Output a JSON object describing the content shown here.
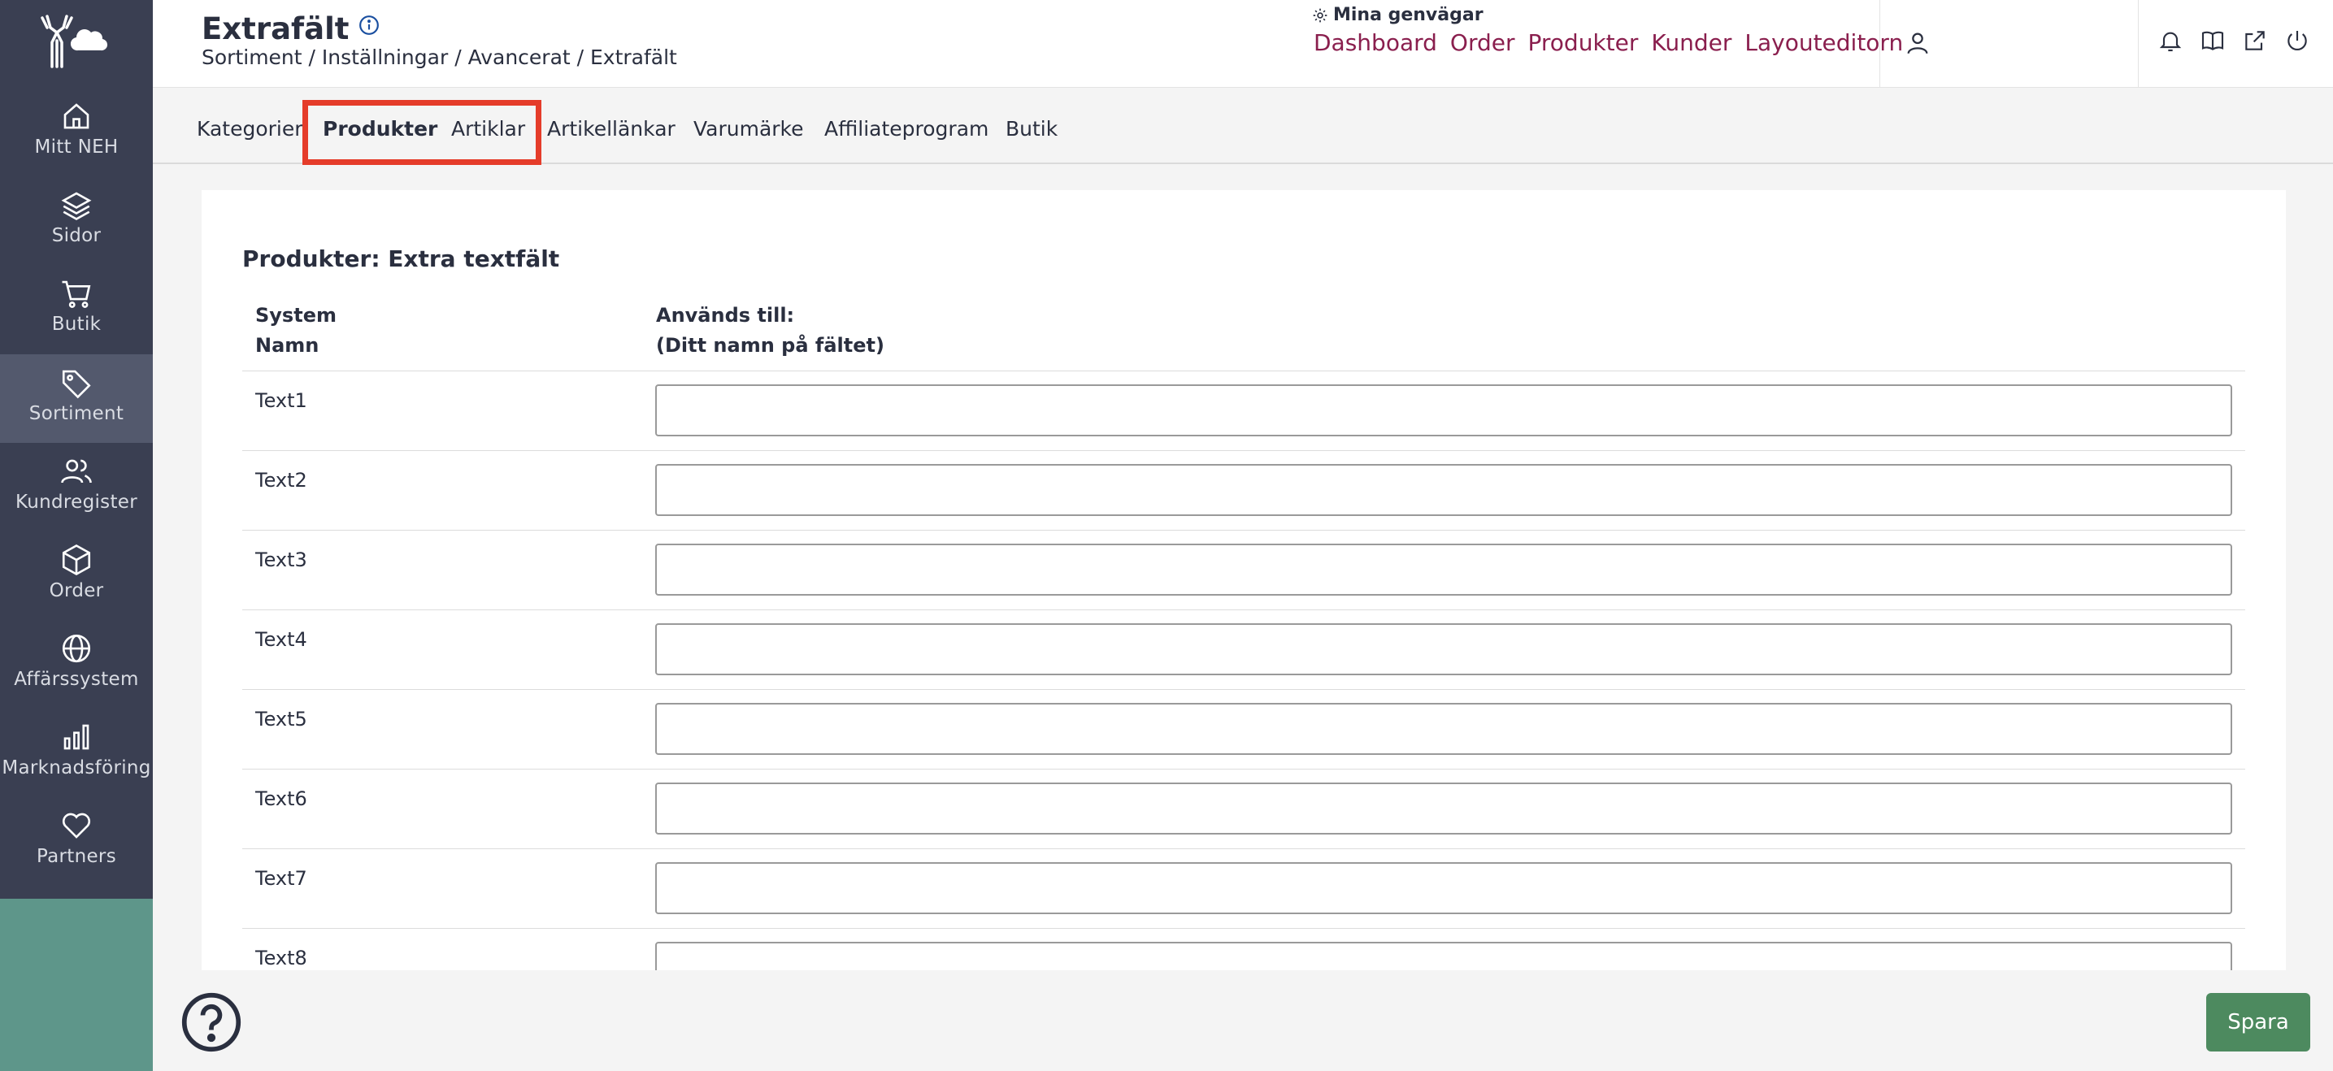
{
  "sidebar": {
    "items": [
      {
        "label": "Mitt NEH",
        "icon": "home-icon"
      },
      {
        "label": "Sidor",
        "icon": "layers-icon"
      },
      {
        "label": "Butik",
        "icon": "cart-icon"
      },
      {
        "label": "Sortiment",
        "icon": "tag-icon"
      },
      {
        "label": "Kundregister",
        "icon": "users-icon"
      },
      {
        "label": "Order",
        "icon": "box-icon"
      },
      {
        "label": "Affärssystem",
        "icon": "globe-icon"
      },
      {
        "label": "Marknadsföring",
        "icon": "bar-chart-icon"
      },
      {
        "label": "Partners",
        "icon": "heart-icon"
      }
    ],
    "active": "Sortiment"
  },
  "header": {
    "title": "Extrafält",
    "breadcrumb": "Sortiment / Inställningar / Avancerat / Extrafält",
    "shortcuts_title": "Mina genvägar",
    "shortcuts": [
      "Dashboard",
      "Order",
      "Produkter",
      "Kunder",
      "Layouteditorn"
    ]
  },
  "tabs": [
    "Kategorier",
    "Produkter",
    "Artiklar",
    "Artikellänkar",
    "Varumärke",
    "Affiliateprogram",
    "Butik"
  ],
  "section": {
    "title": "Produkter: Extra textfält",
    "col_system": "System",
    "col_name": "Namn",
    "col_used": "Används till:",
    "col_used_sub": "(Ditt namn på fältet)",
    "rows": [
      {
        "label": "Text1",
        "value": ""
      },
      {
        "label": "Text2",
        "value": ""
      },
      {
        "label": "Text3",
        "value": ""
      },
      {
        "label": "Text4",
        "value": ""
      },
      {
        "label": "Text5",
        "value": ""
      },
      {
        "label": "Text6",
        "value": ""
      },
      {
        "label": "Text7",
        "value": ""
      },
      {
        "label": "Text8",
        "value": ""
      }
    ]
  },
  "footer": {
    "save_label": "Spara"
  },
  "colors": {
    "sidebar_bg": "#3a3f52",
    "sidebar_bottom": "#5e968a",
    "link": "#8a1f4e",
    "highlight": "#e53c2a",
    "save_button": "#4d8a5f"
  }
}
